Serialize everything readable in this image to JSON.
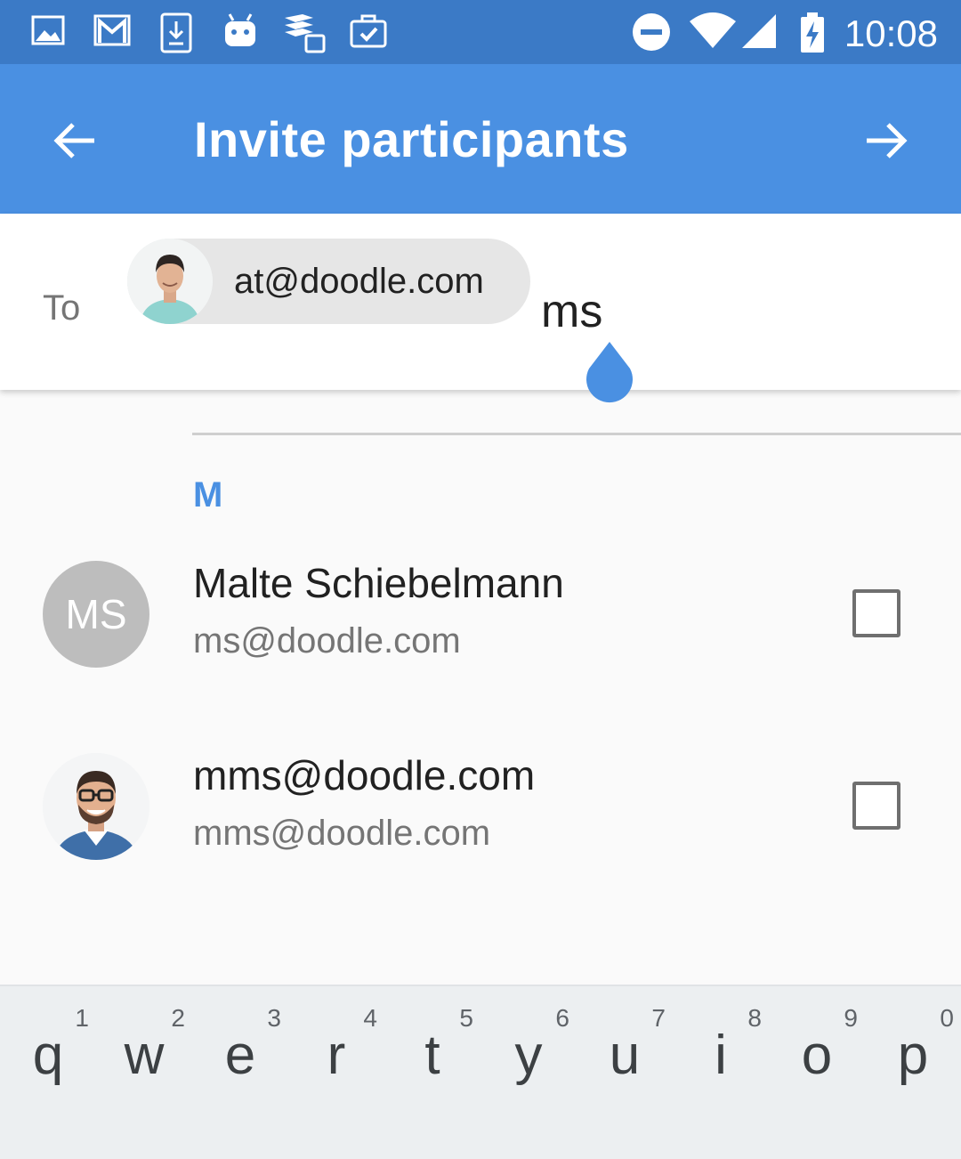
{
  "status_bar": {
    "time": "10:08",
    "icons": [
      "image-icon",
      "gmail-icon",
      "download-icon",
      "android-icon",
      "todoist-icon",
      "briefcase-check-icon",
      "do-not-disturb-icon",
      "wifi-icon",
      "signal-icon",
      "battery-charging-icon"
    ]
  },
  "app_bar": {
    "title": "Invite participants",
    "back_icon": "arrow-left-icon",
    "next_icon": "arrow-right-icon"
  },
  "to_field": {
    "label": "To",
    "chip_email": "at@doodle.com",
    "typed_value": "ms"
  },
  "results": {
    "section_letter": "M",
    "contacts": [
      {
        "name": "Malte Schiebelmann",
        "email": "ms@doodle.com",
        "initials": "MS"
      },
      {
        "name": "mms@doodle.com",
        "email": "mms@doodle.com",
        "initials": ""
      }
    ]
  },
  "keyboard": {
    "keys": [
      {
        "letter": "q",
        "hint": "1"
      },
      {
        "letter": "w",
        "hint": "2"
      },
      {
        "letter": "e",
        "hint": "3"
      },
      {
        "letter": "r",
        "hint": "4"
      },
      {
        "letter": "t",
        "hint": "5"
      },
      {
        "letter": "y",
        "hint": "6"
      },
      {
        "letter": "u",
        "hint": "7"
      },
      {
        "letter": "i",
        "hint": "8"
      },
      {
        "letter": "o",
        "hint": "9"
      },
      {
        "letter": "p",
        "hint": "0"
      }
    ]
  },
  "colors": {
    "status_bar": "#3b7ac6",
    "app_bar": "#4a90e2",
    "accent": "#4a90e2",
    "avatar_initials_bg": "#bdbdbd",
    "keyboard_bg": "#eceff1"
  }
}
